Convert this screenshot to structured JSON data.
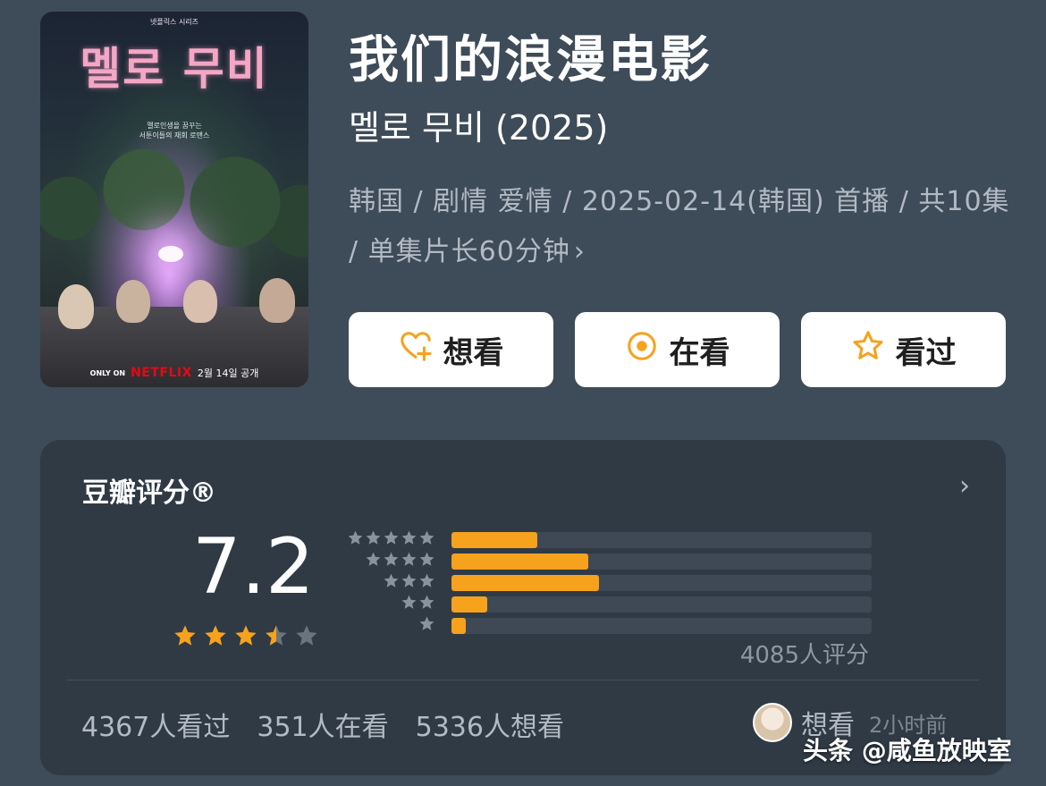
{
  "poster": {
    "top_label": "넷플릭스 시리즈",
    "title": "멜로 무비",
    "tagline_1": "멜로인생을 꿈꾸는",
    "tagline_2": "서툰이들의 재회 로맨스",
    "only_on": "ONLY ON",
    "brand": "NETFLIX",
    "release": "2월 14일 공개"
  },
  "header": {
    "title": "我们的浪漫电影",
    "original_title": "멜로 무비 (2025)",
    "meta": "韩国 / 剧情 爱情 / 2025-02-14(韩国) 首播 / 共10集 / 单集片长60分钟",
    "meta_chevron": "›"
  },
  "actions": {
    "want_label": "想看",
    "watching_label": "在看",
    "watched_label": "看过",
    "icon_color": "#f6a21d"
  },
  "rating": {
    "title": "豆瓣评分®",
    "chevron": "›",
    "score": "7.2",
    "stars_value": 3.5,
    "rating_count": "4085人评分",
    "distribution": [
      {
        "stars": 5,
        "fraction": 0.205
      },
      {
        "stars": 4,
        "fraction": 0.325
      },
      {
        "stars": 3,
        "fraction": 0.35
      },
      {
        "stars": 2,
        "fraction": 0.085
      },
      {
        "stars": 1,
        "fraction": 0.035
      }
    ],
    "bar_color": "#f6a21d"
  },
  "stats": {
    "watched": "4367人看过",
    "watching": "351人在看",
    "want": "5336人想看"
  },
  "friend": {
    "action": "想看",
    "time": "2小时前"
  },
  "watermark": "头条 @咸鱼放映室"
}
